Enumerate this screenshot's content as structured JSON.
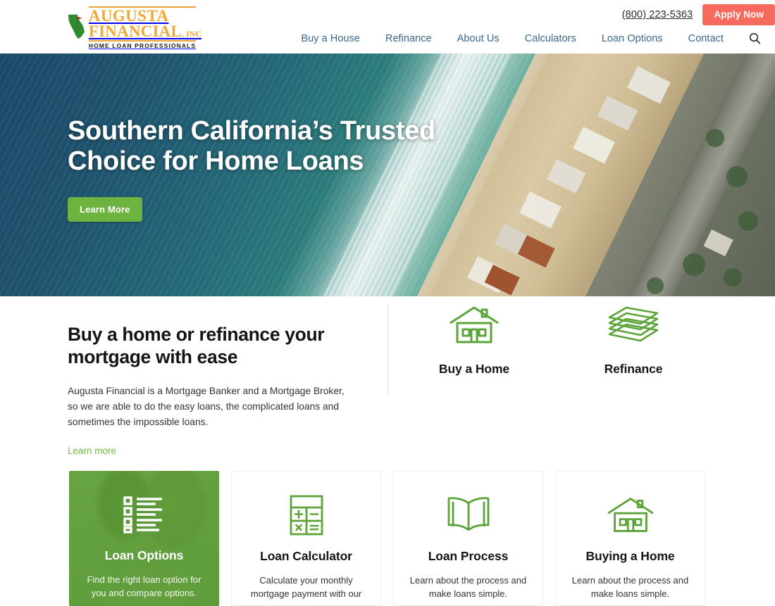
{
  "header": {
    "logo": {
      "brand_line1": "AUGUSTA",
      "brand_line2": "FINANCIAL",
      "brand_suffix": ", INC",
      "tagline": "HOME LOAN PROFESSIONALS",
      "brand_color": "#F0A933",
      "state_color": "#2E8B30",
      "flag_color": "#D02020"
    },
    "phone": "(800) 223-5363",
    "apply_label": "Apply Now",
    "apply_color": "#F76B5E",
    "nav_color": "#38678E",
    "nav": [
      {
        "label": "Buy a House"
      },
      {
        "label": "Refinance"
      },
      {
        "label": "About Us"
      },
      {
        "label": "Calculators"
      },
      {
        "label": "Loan Options"
      },
      {
        "label": "Contact"
      }
    ],
    "search_icon": "search-icon"
  },
  "hero": {
    "title_line1": "Southern California’s Trusted",
    "title_line2": "Choice for Home Loans",
    "button_label": "Learn More",
    "button_color": "#6CB33F"
  },
  "intro": {
    "heading_line1": "Buy a home or refinance your",
    "heading_line2": "mortgage with ease",
    "body": "Augusta Financial is a Mortgage Banker and a Mortgage Broker, so we are able to do the easy loans, the complicated loans and sometimes the impossible loans.",
    "link_label": "Learn more",
    "link_color": "#72B943",
    "features": [
      {
        "label": "Buy a Home",
        "icon": "house-icon"
      },
      {
        "label": "Refinance",
        "icon": "money-stack-icon"
      }
    ]
  },
  "cards": [
    {
      "title": "Loan Options",
      "desc": "Find the right loan option for you and compare options.",
      "icon": "checklist-icon",
      "featured": true,
      "accent": "#5CA338"
    },
    {
      "title": "Loan Calculator",
      "desc": "Calculate your monthly mortgage payment with our",
      "icon": "calculator-icon",
      "featured": false,
      "accent": "#5CA338"
    },
    {
      "title": "Loan Process",
      "desc": "Learn about the process and make loans simple.",
      "icon": "open-book-icon",
      "featured": false,
      "accent": "#5CA338"
    },
    {
      "title": "Buying a Home",
      "desc": "Learn about the process and make loans simple.",
      "icon": "house-icon",
      "featured": false,
      "accent": "#5CA338"
    }
  ]
}
